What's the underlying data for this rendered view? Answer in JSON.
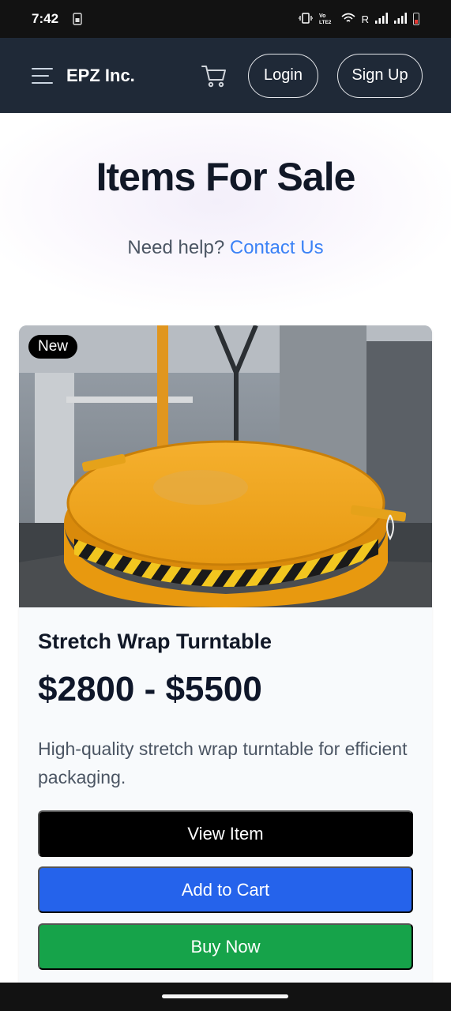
{
  "status_bar": {
    "time": "7:42",
    "network_label": "R",
    "icons": [
      "sim-icon",
      "vibrate-icon",
      "volte-icon",
      "wifi-icon",
      "signal-icon",
      "signal-icon",
      "battery-low-icon"
    ]
  },
  "navbar": {
    "brand": "EPZ Inc.",
    "login_label": "Login",
    "signup_label": "Sign Up",
    "icons": [
      "menu-icon",
      "cart-icon"
    ]
  },
  "hero": {
    "title": "Items For Sale",
    "help_text": "Need help?",
    "contact_link": "Contact Us"
  },
  "product": {
    "badge": "New",
    "title": "Stretch Wrap Turntable",
    "price": "$2800 - $5500",
    "description": "High-quality stretch wrap turntable for efficient packaging.",
    "view_label": "View Item",
    "cart_label": "Add to Cart",
    "buy_label": "Buy Now"
  },
  "colors": {
    "navbar_bg": "#1f2937",
    "link": "#3b82f6",
    "add_to_cart": "#2563eb",
    "buy_now": "#16a34a",
    "view_item": "#000000"
  }
}
